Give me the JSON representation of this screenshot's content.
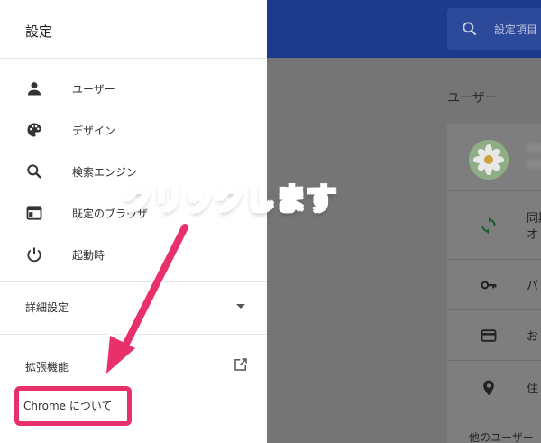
{
  "drawer": {
    "title": "設定",
    "items": [
      {
        "label": "ユーザー",
        "icon": "person-icon"
      },
      {
        "label": "デザイン",
        "icon": "palette-icon"
      },
      {
        "label": "検索エンジン",
        "icon": "search-icon"
      },
      {
        "label": "既定のブラウザ",
        "icon": "browser-icon"
      },
      {
        "label": "起動時",
        "icon": "power-icon"
      }
    ],
    "advanced_label": "詳細設定",
    "extensions_label": "拡張機能",
    "about_label": "Chrome について"
  },
  "header": {
    "search_placeholder": "設定項目"
  },
  "main": {
    "section_title": "ユーザー",
    "rows": [
      {
        "text": "同期\nオ",
        "icon": "sync-icon"
      },
      {
        "text": "パ",
        "icon": "key-icon"
      },
      {
        "text": "お",
        "icon": "credit-card-icon"
      },
      {
        "text": "住",
        "icon": "location-pin-icon"
      }
    ],
    "other_users": "他のユーザー"
  },
  "annotation": {
    "callout": "クリックします"
  },
  "colors": {
    "accent_highlight": "#e8316a",
    "callout_text": "#ff3d7f",
    "topbar": "#1e3a8a"
  }
}
